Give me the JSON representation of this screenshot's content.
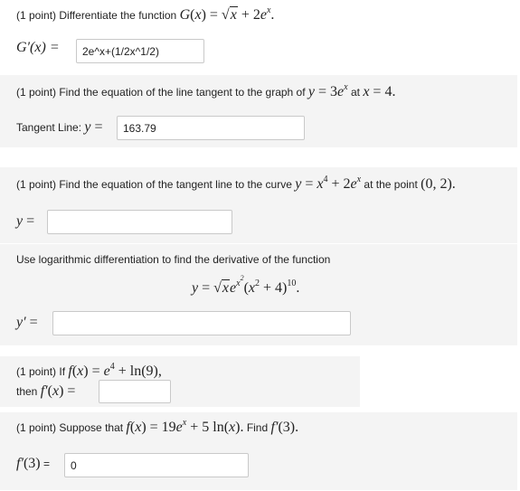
{
  "problem1": {
    "prefix": "(1 point) Differentiate the function",
    "answer_label_math": "G′(x) =",
    "answer_value": "2e^x+(1/2x^1/2)"
  },
  "problem2": {
    "prefix": "(1 point) Find the equation of the line tangent to the graph of",
    "at_word": "at",
    "answer_label": "Tangent Line:",
    "answer_value": "163.79"
  },
  "problem3": {
    "prefix": "(1 point) Find the equation of the tangent line to the curve",
    "suffix": "at the point",
    "answer_value": ""
  },
  "problem4": {
    "prefix": "Use logarithmic differentiation to find the derivative of the function",
    "answer_value": ""
  },
  "problem5": {
    "prefix": "(1 point) If",
    "then_word": "then",
    "answer_value": ""
  },
  "problem6": {
    "prefix": "(1 point) Suppose that",
    "find_word": "Find",
    "answer_label_eq": "=",
    "answer_value": "0"
  }
}
